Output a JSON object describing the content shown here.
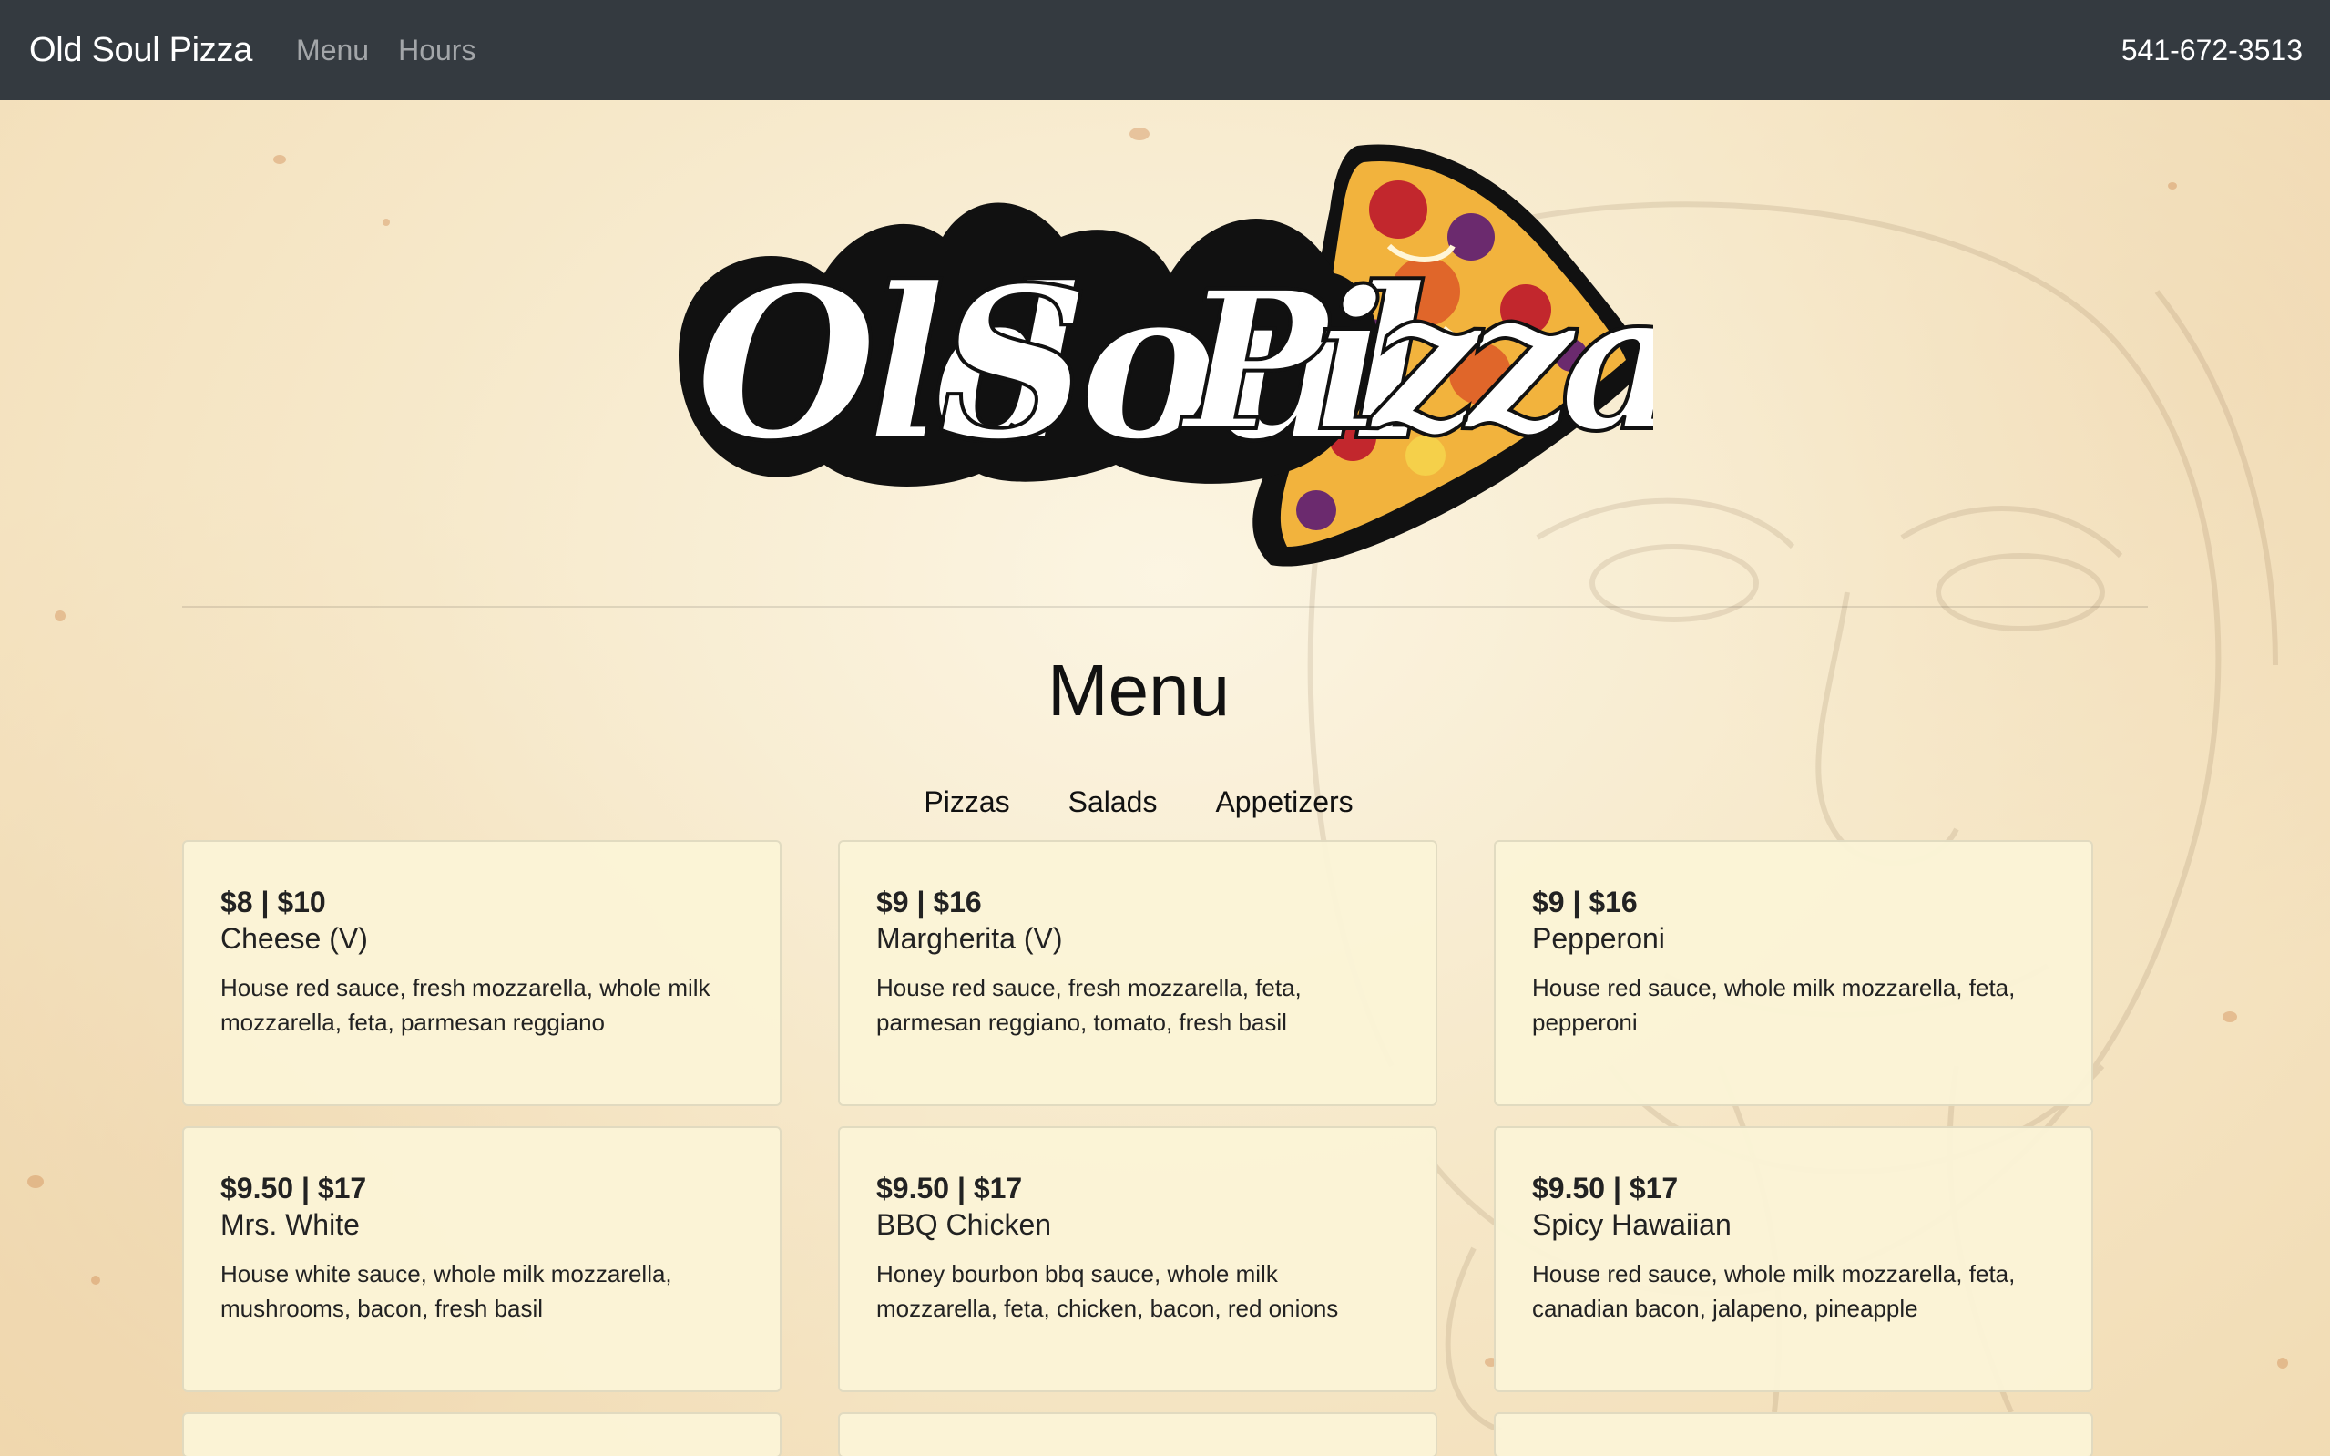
{
  "navbar": {
    "brand": "Old Soul Pizza",
    "links": [
      "Menu",
      "Hours"
    ],
    "phone": "541-672-3513"
  },
  "logo": {
    "text": "Old Soul Pizza",
    "colors": {
      "outline": "#111111",
      "accents": [
        "#f2b33d",
        "#e0662a",
        "#c2272d",
        "#6b2a6e",
        "#f5d04a"
      ]
    }
  },
  "menu": {
    "title": "Menu",
    "tabs": [
      "Pizzas",
      "Salads",
      "Appetizers"
    ],
    "items": [
      {
        "price": "$8 | $10",
        "name": "Cheese (V)",
        "desc": "House red sauce, fresh mozzarella, whole milk mozzarella, feta, parmesan reggiano"
      },
      {
        "price": "$9 | $16",
        "name": "Margherita (V)",
        "desc": "House red sauce, fresh mozzarella, feta, parmesan reggiano, tomato, fresh basil"
      },
      {
        "price": "$9 | $16",
        "name": "Pepperoni",
        "desc": "House red sauce, whole milk mozzarella, feta, pepperoni"
      },
      {
        "price": "$9.50 | $17",
        "name": "Mrs. White",
        "desc": "House white sauce, whole milk mozzarella, mushrooms, bacon, fresh basil"
      },
      {
        "price": "$9.50 | $17",
        "name": "BBQ Chicken",
        "desc": "Honey bourbon bbq sauce, whole milk mozzarella, feta, chicken, bacon, red onions"
      },
      {
        "price": "$9.50 | $17",
        "name": "Spicy Hawaiian",
        "desc": "House red sauce, whole milk mozzarella, feta, canadian bacon, jalapeno, pineapple"
      }
    ]
  },
  "theme": {
    "navbar_bg": "#343a40",
    "card_bg": "#fbf4d6",
    "paper_bg": "#f3e2bf"
  }
}
